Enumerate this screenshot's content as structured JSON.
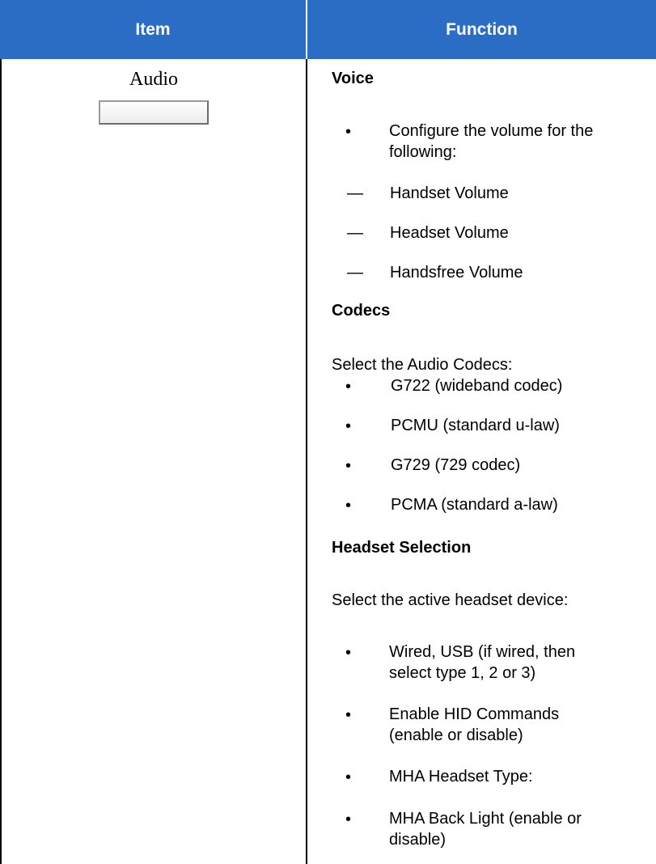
{
  "header": {
    "item": "Item",
    "function": "Function"
  },
  "row": {
    "item_label": "Audio",
    "voice": {
      "heading": "Voice",
      "configure_line1": "Configure the volume for the",
      "configure_line2": "following:",
      "volumes": [
        "Handset Volume",
        "Headset Volume",
        "Handsfree Volume"
      ],
      "dash": "—"
    },
    "codecs": {
      "heading": "Codecs",
      "intro": "Select the Audio Codecs:",
      "items": [
        "G722 (wideband codec)",
        "PCMU (standard u-law)",
        "G729 (729 codec)",
        "PCMA (standard a-law)"
      ]
    },
    "headset": {
      "heading": "Headset Selection",
      "intro": "Select the active headset device:",
      "wired_line1": "Wired, USB (if wired, then",
      "wired_line2": "select type 1, 2 or 3)",
      "hid_line1": "Enable HID Commands",
      "hid_line2": "(enable or disable)",
      "mha_type": "MHA Headset Type:",
      "backlight_line1": "MHA Back Light (enable or",
      "backlight_line2": "disable)"
    },
    "bullet": "•"
  }
}
